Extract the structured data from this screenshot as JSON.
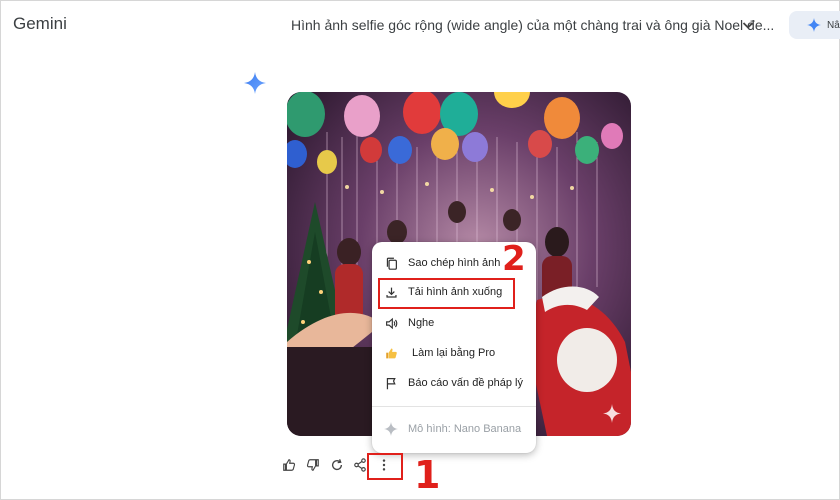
{
  "header": {
    "app_name": "Gemini",
    "chat_title": "Hình ảnh selfie góc rộng (wide angle) của một chàng trai và ông già Noel đe...",
    "share_label": "Nâ"
  },
  "context_menu": {
    "items": [
      {
        "label": "Sao chép hình ảnh",
        "icon": "copy-icon"
      },
      {
        "label": "Tải hình ảnh xuống",
        "icon": "download-icon"
      },
      {
        "label": "Nghe",
        "icon": "speaker-icon"
      },
      {
        "label": "Làm lại bằng Pro",
        "icon": "thumbs-up-emoji-icon"
      },
      {
        "label": "Báo cáo vấn đề pháp lý",
        "icon": "flag-icon"
      }
    ],
    "model_label": "Mô hình: Nano Banana"
  },
  "annotations": {
    "step1": "1",
    "step2": "2",
    "highlight_color": "#e0201b"
  },
  "colors": {
    "accent": "#4285f4",
    "share_bg": "#e9eef6"
  }
}
